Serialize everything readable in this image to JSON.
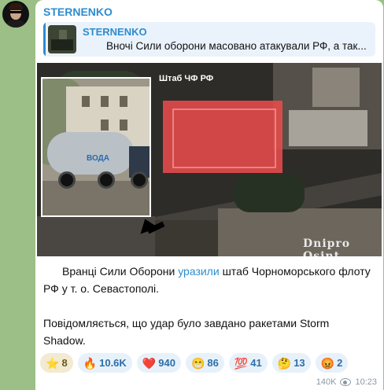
{
  "channel": {
    "name": "STERNENKO"
  },
  "reply": {
    "name": "STERNENKO",
    "text": "Вночі Сили оборони масовано атакували РФ, а так..."
  },
  "photo": {
    "label": "Штаб ЧФ РФ",
    "inset_label": "ВОДА",
    "watermark": "Dnipro Osint"
  },
  "message": {
    "line1_before": "Вранці Сили Оборони ",
    "line1_link": "уразили",
    "line1_after": " штаб Чорноморського флоту РФ у т. о. Севастополі.",
    "line2": "Повідомляється, що удар було завдано ракетами Storm Shadow."
  },
  "reactions": [
    {
      "emoji": "⭐",
      "count": "8"
    },
    {
      "emoji": "🔥",
      "count": "10.6K"
    },
    {
      "emoji": "❤️",
      "count": "940"
    },
    {
      "emoji": "😁",
      "count": "86"
    },
    {
      "emoji": "💯",
      "count": "41"
    },
    {
      "emoji": "🤔",
      "count": "13"
    },
    {
      "emoji": "😡",
      "count": "2"
    }
  ],
  "footer": {
    "views": "140K",
    "time": "10:23"
  },
  "colors": {
    "background": "#9bbf86",
    "accent": "#2d8ccf",
    "reaction_bg": "#e7f1fa"
  },
  "icons": {
    "views": "eye-icon"
  }
}
